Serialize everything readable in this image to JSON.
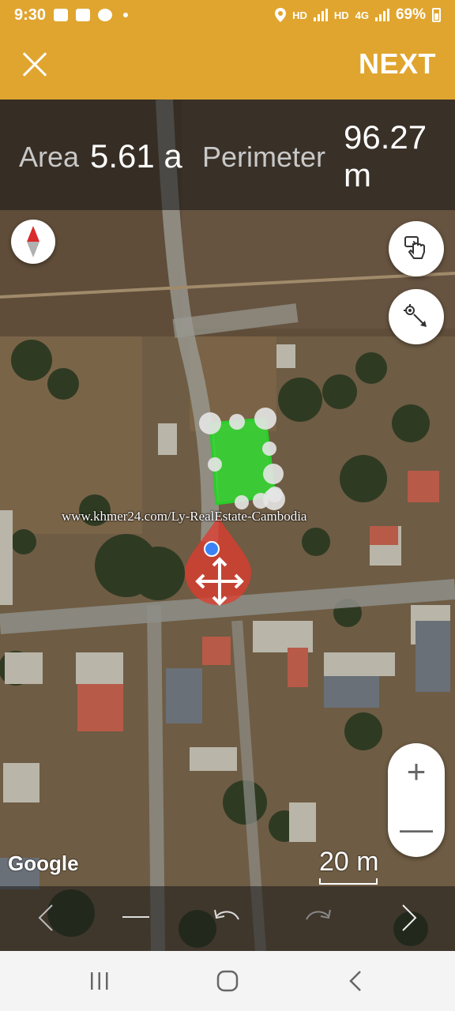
{
  "status_bar": {
    "time": "9:30",
    "network_hd_1": "HD",
    "network_hd_2": "HD",
    "network_type": "4G",
    "battery": "69%"
  },
  "app_bar": {
    "next_label": "NEXT",
    "close_icon": "close-icon"
  },
  "measure": {
    "area_label": "Area",
    "area_value": "5.61 a",
    "perimeter_label": "Perimeter",
    "perimeter_value": "96.27 m"
  },
  "map": {
    "watermark": "www.khmer24.com/Ly-RealEstate-Cambodia",
    "attribution": "Google",
    "scale": "20 m",
    "zoom_in": "+",
    "zoom_out": "—",
    "polygon_color": "#33dd33",
    "marker_color": "#e23b2e"
  },
  "colors": {
    "accent": "#e0a52f"
  }
}
